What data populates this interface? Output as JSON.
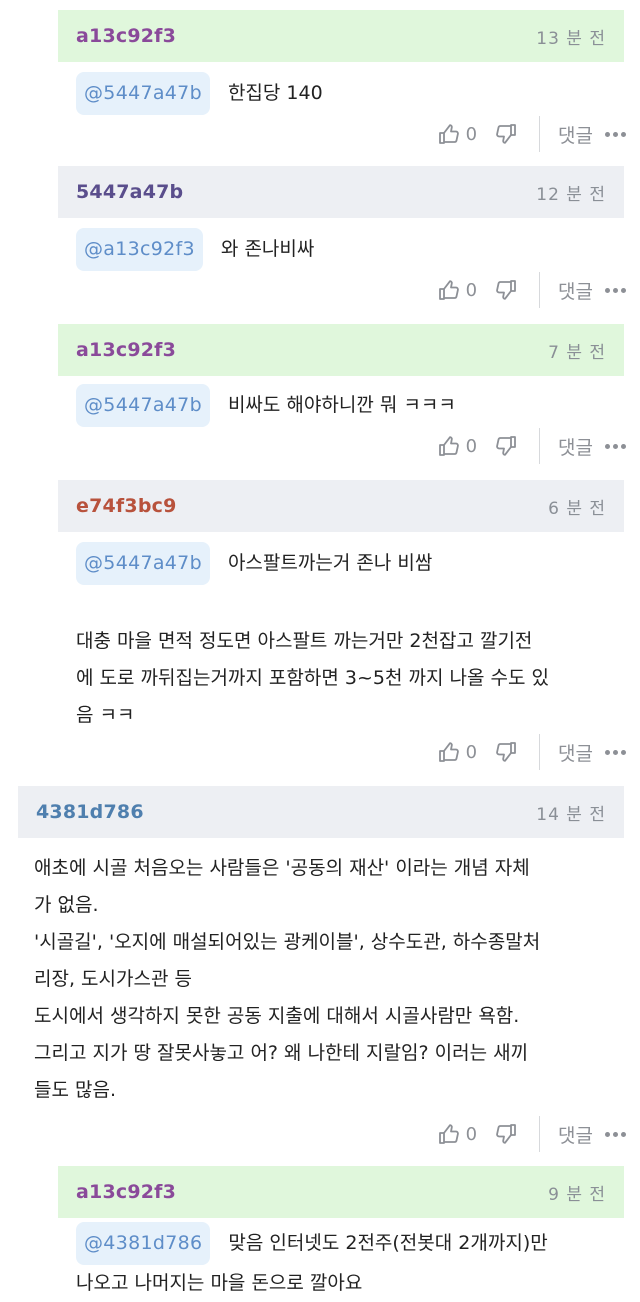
{
  "comments": [
    {
      "author": "a13c92f3",
      "author_color": "#8a4a9a",
      "time": "13 분 전",
      "mention": "@5447a47b",
      "lines": [
        "한집당 140"
      ],
      "likes": "0",
      "reply": "댓글"
    },
    {
      "author": "5447a47b",
      "author_color": "#5a4e8c",
      "time": "12 분 전",
      "mention": "@a13c92f3",
      "lines": [
        "와 존나비싸"
      ],
      "likes": "0",
      "reply": "댓글"
    },
    {
      "author": "a13c92f3",
      "author_color": "#8a4a9a",
      "time": "7 분 전",
      "mention": "@5447a47b",
      "lines": [
        "비싸도 해야하니깐 뭐 ㅋㅋㅋ"
      ],
      "likes": "0",
      "reply": "댓글"
    },
    {
      "author": "e74f3bc9",
      "author_color": "#b8523c",
      "time": "6 분 전",
      "mention": "@5447a47b",
      "lines": [
        "아스팔트까는거 존나 비쌈",
        "대충 마을 면적 정도면 아스팔트 까는거만 2천잡고 깔기전",
        "에 도로 까뒤집는거까지 포함하면 3~5천 까지 나올 수도 있",
        "음 ㅋㅋ"
      ],
      "likes": "0",
      "reply": "댓글"
    },
    {
      "author": "4381d786",
      "author_color": "#4f7fae",
      "time": "14 분 전",
      "mention": "",
      "lines": [
        "애초에 시골 처음오는 사람들은 '공동의 재산' 이라는 개념 자체",
        "가 없음.",
        "'시골길', '오지에 매설되어있는 광케이블', 상수도관, 하수종말처",
        "리장, 도시가스관 등",
        "도시에서 생각하지 못한 공동 지출에 대해서 시골사람만 욕함.",
        "그리고 지가 땅 잘못사놓고 어? 왜 나한테 지랄임? 이러는 새끼",
        "들도 많음."
      ],
      "likes": "0",
      "reply": "댓글"
    },
    {
      "author": "a13c92f3",
      "author_color": "#8a4a9a",
      "time": "9 분 전",
      "mention": "@4381d786",
      "lines": [
        "맞음 인터넷도 2전주(전봇대 2개까지)만",
        "나오고 나머지는 마을 돈으로 깔아요"
      ],
      "likes": "",
      "reply": ""
    }
  ]
}
